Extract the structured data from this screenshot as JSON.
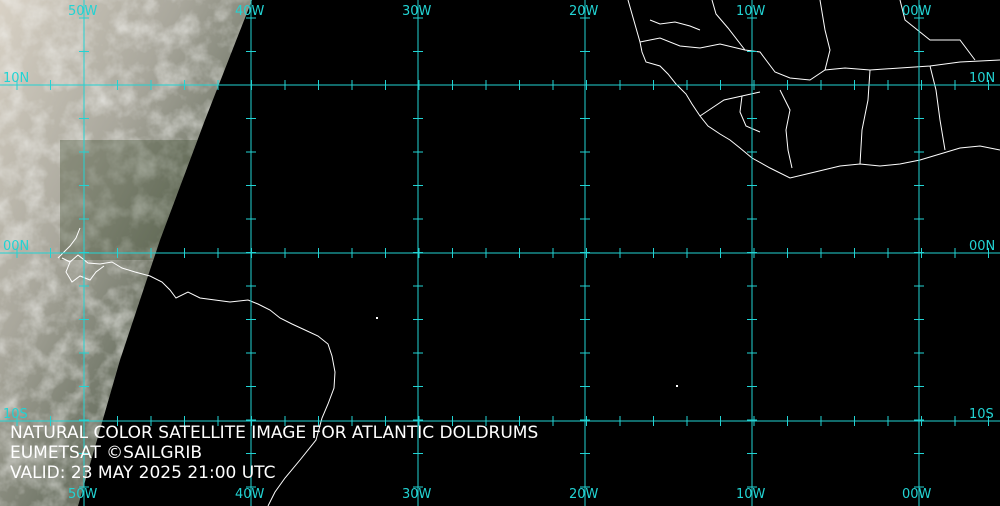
{
  "caption": {
    "title": "NATURAL COLOR SATELLITE IMAGE FOR ATLANTIC DOLDRUMS",
    "credit": "EUMETSAT ©SAILGRIB",
    "valid": "VALID:  23 MAY 2025 21:00 UTC"
  },
  "longitude_labels": [
    "50W",
    "40W",
    "30W",
    "20W",
    "10W",
    "00W"
  ],
  "latitude_labels": [
    "10N",
    "00N",
    "10S"
  ],
  "colors": {
    "grid": "#22d3d3",
    "coast": "#ffffff",
    "caption": "#ffffff",
    "background": "#000000"
  }
}
